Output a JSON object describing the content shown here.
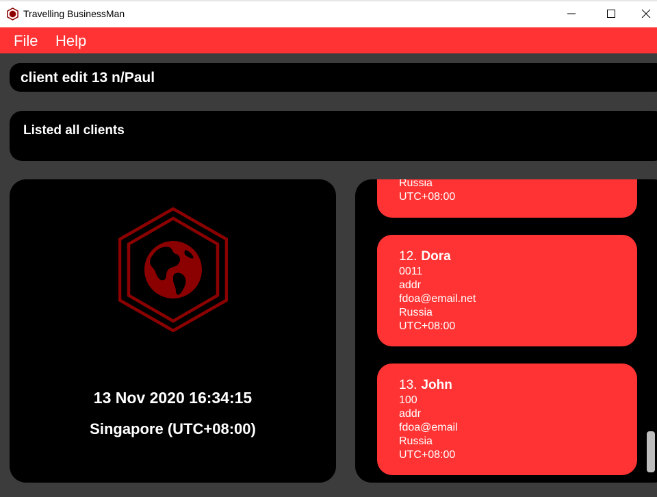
{
  "window": {
    "title": "Travelling BusinessMan",
    "colors": {
      "titlebar": "#ffffff",
      "menubar": "#ff3333",
      "background": "#3c3c3c",
      "panel": "#000000",
      "card": "#ff3333",
      "logo": "#8b0000"
    }
  },
  "menu": {
    "file_label": "File",
    "help_label": "Help"
  },
  "command": {
    "value": "client edit 13 n/Paul"
  },
  "result": {
    "text": "Listed all clients"
  },
  "clock": {
    "datetime": "13 Nov 2020 16:34:15",
    "timezone": "Singapore (UTC+08:00)",
    "icon": "globe-icon"
  },
  "clients": [
    {
      "country": "Russia",
      "timezone": "UTC+08:00"
    },
    {
      "index": "12.",
      "name": "Dora",
      "phone": "0011",
      "address": "addr",
      "email": "fdoa@email.net",
      "country": "Russia",
      "timezone": "UTC+08:00"
    },
    {
      "index": "13.",
      "name": "John",
      "phone": "100",
      "address": "addr",
      "email": "fdoa@email",
      "country": "Russia",
      "timezone": "UTC+08:00"
    }
  ]
}
